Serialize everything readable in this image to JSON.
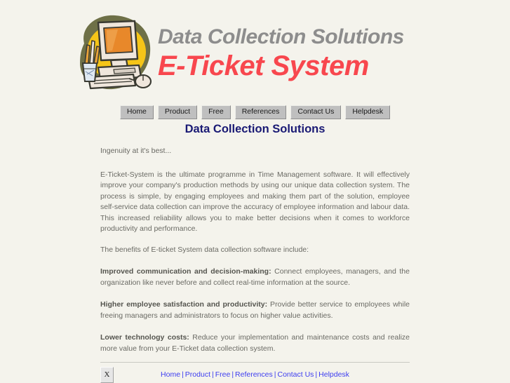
{
  "banner": {
    "logo_icon": "computer-workstation-icon",
    "line1": "Data Collection Solutions",
    "line2": "E-TICKET SYSTEM",
    "line2_display": "E-Ticket System",
    "colors": {
      "line1": "#8d8d8d",
      "line2": "#f8474e",
      "logo_blob_olive": "#6e7047",
      "logo_blob_yellow": "#f5c518",
      "logo_screen": "#e8882a",
      "logo_case": "#efe6dc"
    }
  },
  "nav": {
    "items": [
      {
        "label": "Home"
      },
      {
        "label": "Product"
      },
      {
        "label": "Free"
      },
      {
        "label": "References"
      },
      {
        "label": "Contact Us"
      },
      {
        "label": "Helpdesk"
      }
    ]
  },
  "main": {
    "title": "Data Collection Solutions",
    "title_color": "#191974",
    "tagline": "Ingenuity at it's best...",
    "intro": "E-Ticket-System is the ultimate programme in Time Management software. It will effectively improve your company's production methods by using our unique data collection system. The process is simple, by engaging employees and making them part of the solution, employee self-service data collection can improve the accuracy of employee information and labour data. This increased reliability allows you to make better decisions when it comes to workforce productivity and performance.",
    "benefits_lead_in": "The benefits of E-ticket System data collection software include:",
    "benefits": [
      {
        "heading": "Improved communication and decision-making:",
        "body": " Connect employees, managers, and the organization like never before and collect real-time information at the source."
      },
      {
        "heading": "Higher employee satisfaction and productivity:",
        "body": " Provide better service to employees while freeing managers and administrators to focus on higher value activities."
      },
      {
        "heading": "Lower technology costs:",
        "body": " Reduce your implementation and maintenance costs and realize more value from your E-Ticket data collection system."
      }
    ],
    "close_button_label": "X"
  },
  "footer": {
    "links": [
      {
        "label": "Home"
      },
      {
        "label": "Product"
      },
      {
        "label": "Free"
      },
      {
        "label": "References"
      },
      {
        "label": "Contact Us"
      },
      {
        "label": "Helpdesk"
      }
    ],
    "separator": "|",
    "link_color": "#3d3df0"
  }
}
